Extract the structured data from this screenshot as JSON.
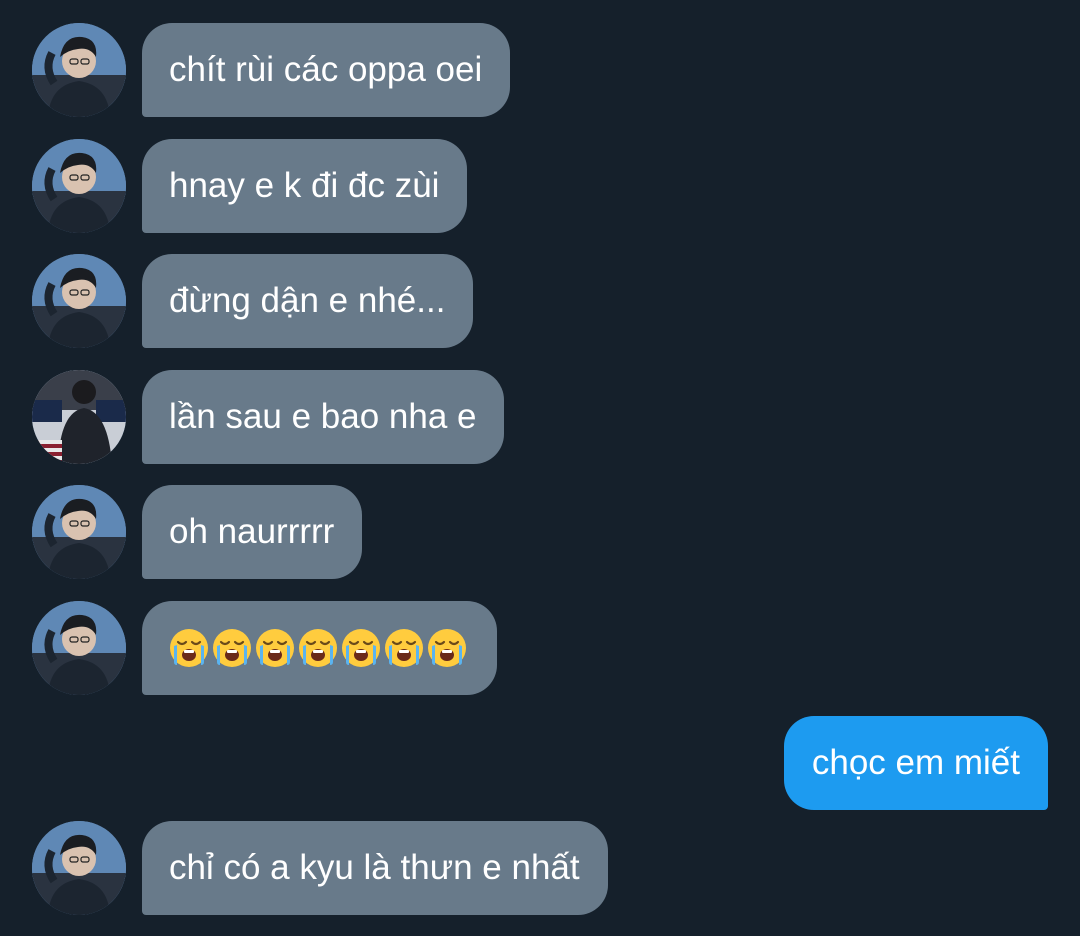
{
  "conversation": {
    "messages": [
      {
        "sender": "them",
        "avatar": "avatar-photo",
        "text": "chít rùi các oppa oei"
      },
      {
        "sender": "them",
        "avatar": "avatar-photo",
        "text": "hnay e k đi đc zùi"
      },
      {
        "sender": "them",
        "avatar": "avatar-photo",
        "text": "đừng dận e nhé..."
      },
      {
        "sender": "them",
        "avatar": "avatar-photo-alt",
        "text": "lần sau e bao nha e"
      },
      {
        "sender": "them",
        "avatar": "avatar-photo",
        "text": "oh naurrrrr"
      },
      {
        "sender": "them",
        "avatar": "avatar-photo",
        "emoji": "loudly-crying-face",
        "emoji_count": 7
      },
      {
        "sender": "me",
        "text": "chọc em miết"
      },
      {
        "sender": "them",
        "avatar": "avatar-photo",
        "text": "chỉ có a kyu là thưn e nhất"
      }
    ]
  },
  "colors": {
    "background": "#15202b",
    "incoming_bubble": "#687a8a",
    "outgoing_bubble": "#1d9bf0",
    "text": "#ffffff"
  }
}
